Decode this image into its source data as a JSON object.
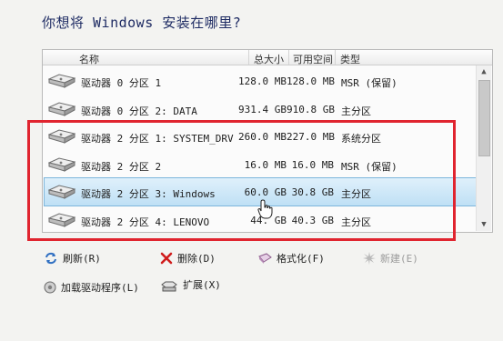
{
  "window": {
    "title": "你想将 Windows 安装在哪里?"
  },
  "table": {
    "columns": {
      "name": "名称",
      "total": "总大小",
      "free": "可用空间",
      "type": "类型"
    },
    "rows": [
      {
        "name": "驱动器 0 分区 1",
        "total": "128.0 MB",
        "free": "128.0 MB",
        "type": "MSR (保留)",
        "selected": false
      },
      {
        "name": "驱动器 0 分区 2: DATA",
        "total": "931.4 GB",
        "free": "910.8 GB",
        "type": "主分区",
        "selected": false
      },
      {
        "name": "驱动器 2 分区 1: SYSTEM_DRV",
        "total": "260.0 MB",
        "free": "227.0 MB",
        "type": "系统分区",
        "selected": false
      },
      {
        "name": "驱动器 2 分区 2",
        "total": "16.0 MB",
        "free": "16.0 MB",
        "type": "MSR (保留)",
        "selected": false
      },
      {
        "name": "驱动器 2 分区 3: Windows",
        "total": "60.0 GB",
        "free": "30.8 GB",
        "type": "主分区",
        "selected": true
      },
      {
        "name": "驱动器 2 分区 4: LENOVO",
        "total": "44. GB",
        "free": "40.3 GB",
        "type": "主分区",
        "selected": false
      }
    ]
  },
  "actions": {
    "refresh": "刷新(R)",
    "delete": "删除(D)",
    "format": "格式化(F)",
    "new": "新建(E)",
    "load_driver": "加载驱动程序(L)",
    "extend": "扩展(X)"
  },
  "colors": {
    "selection": "#bfe0f5",
    "highlight_box": "#e0242f",
    "title": "#1e2b63"
  },
  "icons": [
    "disk-icon",
    "refresh-icon",
    "delete-icon",
    "format-icon",
    "new-icon",
    "load-driver-icon",
    "extend-icon",
    "scroll-up-icon",
    "scroll-down-icon",
    "mouse-cursor-icon"
  ]
}
